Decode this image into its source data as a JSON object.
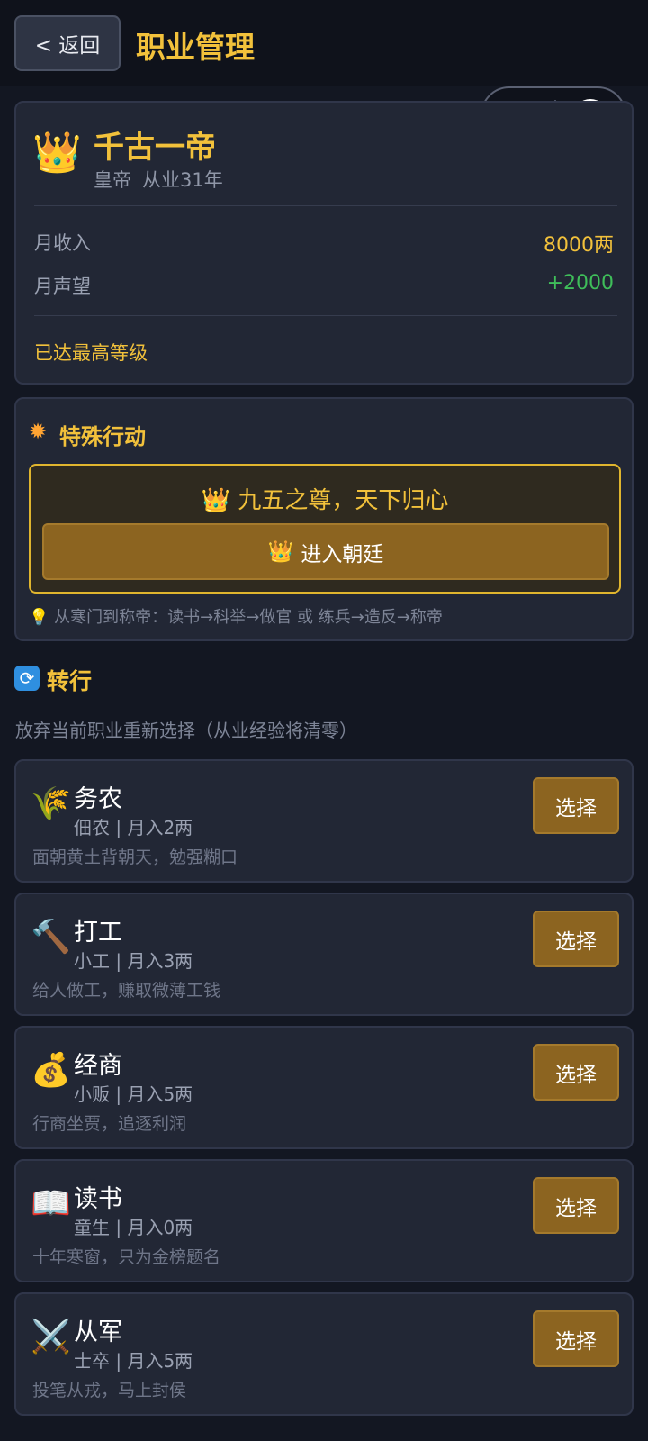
{
  "header": {
    "back_label": "< 返回",
    "title": "职业管理"
  },
  "status": {
    "crown_icon": "crown",
    "career_name": "千古一帝",
    "rank": "皇帝",
    "years": "从业31年",
    "income_label": "月收入",
    "income_value": "8000两",
    "reputation_label": "月声望",
    "reputation_value": "+2000",
    "max_level_text": "已达最高等级",
    "colors": {
      "gold": "#f2c13b",
      "green": "#3fbf5a"
    }
  },
  "special": {
    "title": "特殊行动",
    "slogan": "九五之尊，天下归心",
    "button_label": "进入朝廷",
    "tip": "从寒门到称帝：读书→科举→做官 或 练兵→造反→称帝"
  },
  "switch": {
    "title": "转行",
    "description": "放弃当前职业重新选择（从业经验将清零）",
    "choose_label": "选择",
    "jobs": [
      {
        "icon": "wheat-icon",
        "glyph": "🌾",
        "name": "务农",
        "sub": "佃农 | 月入2两",
        "desc": "面朝黄土背朝天，勉强糊口"
      },
      {
        "icon": "hammer-icon",
        "glyph": "🔨",
        "name": "打工",
        "sub": "小工 | 月入3两",
        "desc": "给人做工，赚取微薄工钱"
      },
      {
        "icon": "money-bag-icon",
        "glyph": "💰",
        "name": "经商",
        "sub": "小贩 | 月入5两",
        "desc": "行商坐贾，追逐利润"
      },
      {
        "icon": "book-icon",
        "glyph": "📖",
        "name": "读书",
        "sub": "童生 | 月入0两",
        "desc": "十年寒窗，只为金榜题名"
      },
      {
        "icon": "crossed-swords-icon",
        "glyph": "⚔️",
        "name": "从军",
        "sub": "士卒 | 月入5两",
        "desc": "投笔从戎，马上封侯"
      }
    ]
  }
}
